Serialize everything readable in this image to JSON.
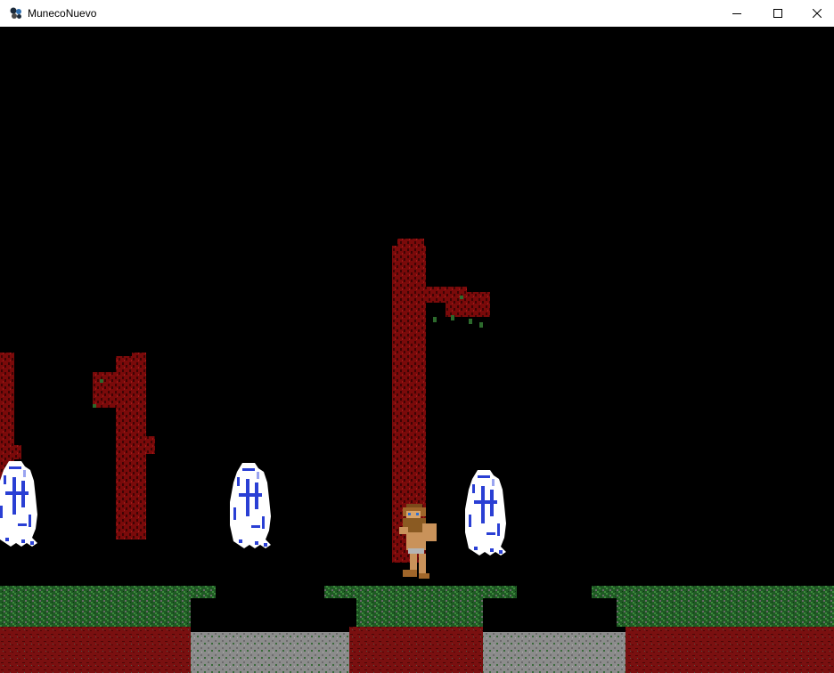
{
  "window": {
    "title": "MunecoNuevo",
    "icon": "app-icon",
    "controls": [
      "minimize-icon",
      "maximize-icon",
      "close-icon"
    ]
  },
  "scene": {
    "background": "#000000",
    "colors": {
      "bark": "#7a0a0a",
      "bark_dark": "#3d0404",
      "grass": "#1f5a24",
      "grass_light": "#3c8a3c",
      "dirt": "#7a1010",
      "stone": "#8c8c8c",
      "ghost": "#ffffff",
      "ghost_accent": "#2a3fd4",
      "skin": "#c9925a",
      "hair": "#7a4a1a"
    }
  }
}
